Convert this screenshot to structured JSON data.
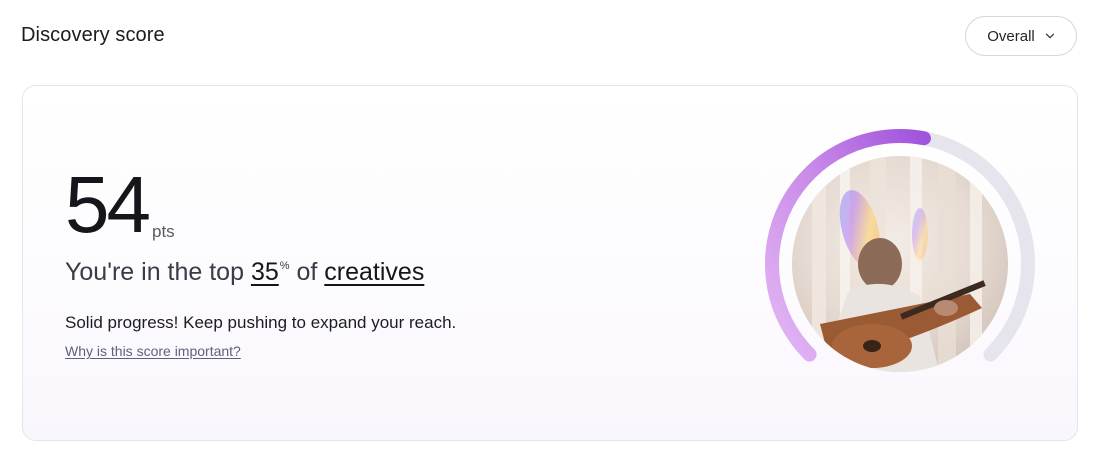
{
  "header": {
    "title": "Discovery score",
    "dropdown_label": "Overall"
  },
  "score": {
    "value": "54",
    "unit": "pts",
    "progress_fraction": 0.54
  },
  "rank": {
    "prefix": "You're in the top ",
    "percentile": "35",
    "percent_sign": "%",
    "middle": " of ",
    "group": "creatives"
  },
  "message": "Solid progress! Keep pushing to expand your reach.",
  "help_link": "Why is this score important?",
  "colors": {
    "gauge_track": "#e6e4ec",
    "gauge_start": "#e3b8f4",
    "gauge_end": "#a053dc"
  },
  "icons": {
    "dropdown": "chevron-down-icon",
    "avatar": "profile-photo"
  }
}
